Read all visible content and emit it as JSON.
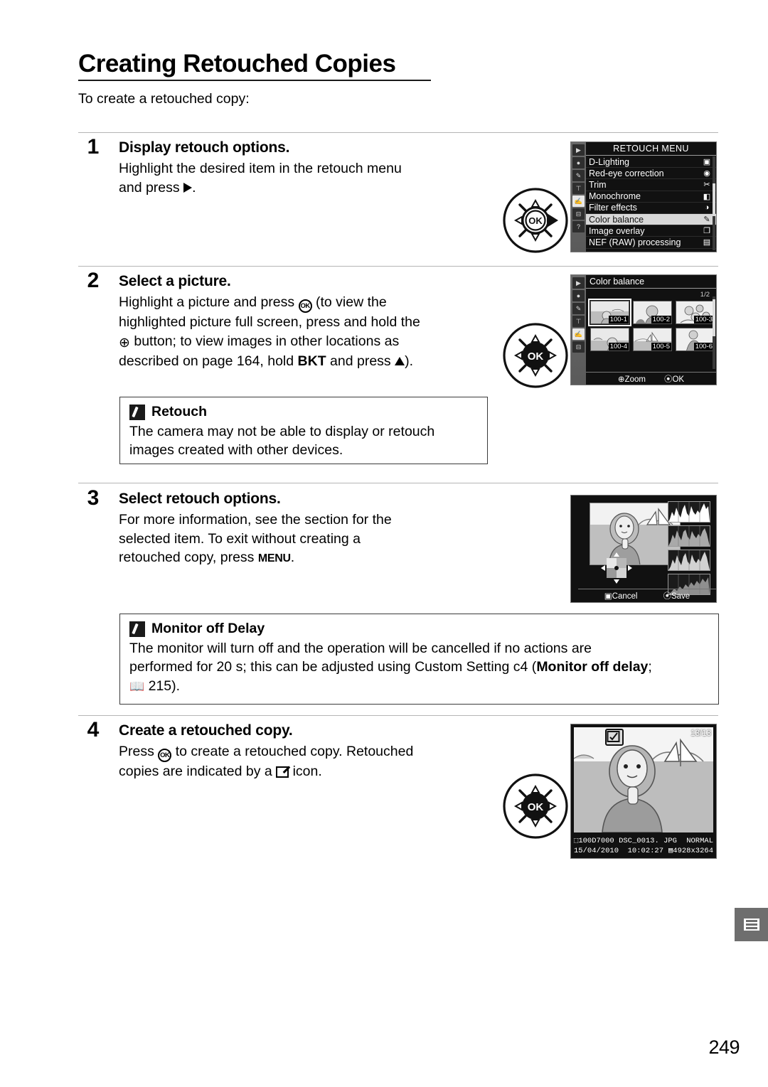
{
  "title": "Creating Retouched Copies",
  "intro": "To create a retouched copy:",
  "page_number": "249",
  "steps": [
    {
      "num": "1",
      "heading": "Display retouch options.",
      "body_line1": "Highlight the desired item in the retouch menu",
      "body_line2_pre": "and press",
      "body_line2_post": "."
    },
    {
      "num": "2",
      "heading": "Select a picture.",
      "l1a": "Highlight a picture and press",
      "l1b": "(to view the",
      "l2": "highlighted picture full screen, press and hold the",
      "l3b": "button; to view images in other locations as",
      "l4a": "described on page 164, hold",
      "l4b": "BKT",
      "l4c": "and press",
      "l4d": ")."
    },
    {
      "num": "3",
      "heading": "Select retouch options.",
      "l1": "For more information, see the section for the",
      "l2": "selected item.  To exit without creating a",
      "l3a": "retouched copy, press",
      "l3b": "MENU",
      "l3c": "."
    },
    {
      "num": "4",
      "heading": "Create a retouched copy.",
      "l1a": "Press",
      "l1b": "to create a retouched copy.  Retouched",
      "l2a": "copies are indicated by a",
      "l2b": "icon."
    }
  ],
  "notes": [
    {
      "title": "Retouch",
      "body": "The camera may not be able to display or retouch images created with other devices."
    },
    {
      "title": "Monitor off Delay",
      "l1": "The monitor will turn off and the operation will be cancelled if no actions are",
      "l2a": "performed for 20 s; this can be adjusted using Custom Setting c4 (",
      "l2b": "Monitor off delay",
      "l2c": ";",
      "l3": "215)."
    }
  ],
  "retouch_menu": {
    "header": "RETOUCH MENU",
    "side_icons": [
      "playback-icon",
      "shooting-icon",
      "pencil-icon",
      "wrench-icon",
      "retouch-icon",
      "recent-icon",
      "help-icon"
    ],
    "items": [
      {
        "label": "D-Lighting",
        "icon": "d-lighting-icon",
        "selected": false
      },
      {
        "label": "Red-eye correction",
        "icon": "eye-icon",
        "selected": false
      },
      {
        "label": "Trim",
        "icon": "scissors-icon",
        "selected": false
      },
      {
        "label": "Monochrome",
        "icon": "monochrome-icon",
        "selected": false
      },
      {
        "label": "Filter effects",
        "icon": "filter-icon",
        "selected": false
      },
      {
        "label": "Color balance",
        "icon": "color-balance-icon",
        "selected": true
      },
      {
        "label": "Image overlay",
        "icon": "overlay-icon",
        "selected": false
      },
      {
        "label": "NEF (RAW) processing",
        "icon": "raw-icon",
        "selected": false
      }
    ]
  },
  "color_balance_screen": {
    "header": "Color balance",
    "page_indicator": "1/2",
    "thumbnails": [
      {
        "tag": "100-1",
        "selected": true
      },
      {
        "tag": "100-2",
        "selected": false
      },
      {
        "tag": "100-3",
        "selected": false
      },
      {
        "tag": "100-4",
        "selected": false
      },
      {
        "tag": "100-5",
        "selected": false
      },
      {
        "tag": "100-6",
        "selected": false
      }
    ],
    "footer_zoom": "Zoom",
    "footer_ok": "OK"
  },
  "edit_screen": {
    "footer_cancel": "Cancel",
    "footer_save": "Save",
    "histograms": 4
  },
  "playback_screen": {
    "frame_count": "13/13",
    "folder": "100D7000",
    "filename": "DSC_0013. JPG",
    "quality": "NORMAL",
    "date": "15/04/2010",
    "time": "10:02:27",
    "size": "4928x3264",
    "retouch_badge": "retouch-badge-icon"
  }
}
